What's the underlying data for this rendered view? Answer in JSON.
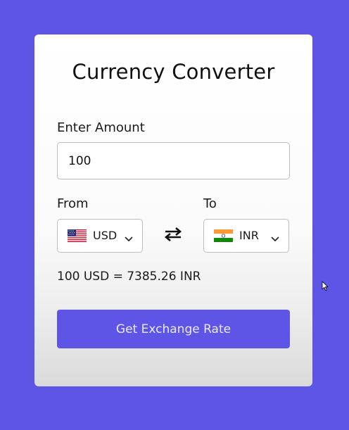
{
  "app": {
    "title": "Currency Converter"
  },
  "amount": {
    "label": "Enter Amount",
    "value": "100"
  },
  "from": {
    "label": "From",
    "currency": "USD",
    "flag_icon": "us-flag-icon"
  },
  "to": {
    "label": "To",
    "currency": "INR",
    "flag_icon": "india-flag-icon"
  },
  "swap_icon": "swap-arrows-icon",
  "result": {
    "text": "100 USD = 7385.26 INR"
  },
  "action": {
    "button_label": "Get Exchange Rate"
  },
  "colors": {
    "background": "#5e55e6",
    "accent": "#5e55e6",
    "button_text": "#ece9ff"
  }
}
